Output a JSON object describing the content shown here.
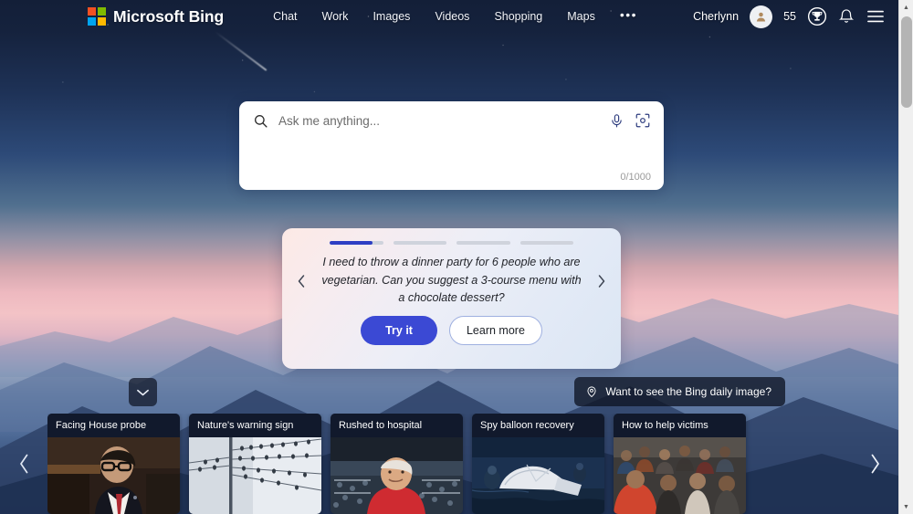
{
  "header": {
    "brand": "Microsoft Bing",
    "logo_colors": [
      "#f25022",
      "#7fba00",
      "#00a4ef",
      "#ffb900"
    ],
    "nav": [
      {
        "label": "Chat",
        "name": "nav-chat"
      },
      {
        "label": "Work",
        "name": "nav-work"
      },
      {
        "label": "Images",
        "name": "nav-images"
      },
      {
        "label": "Videos",
        "name": "nav-videos"
      },
      {
        "label": "Shopping",
        "name": "nav-shopping"
      },
      {
        "label": "Maps",
        "name": "nav-maps"
      }
    ],
    "more_label": "•••",
    "user_name": "Cherlynn",
    "reward_points": "55"
  },
  "search": {
    "placeholder": "Ask me anything...",
    "value": "",
    "char_count": "0/1000"
  },
  "suggestion_card": {
    "progress": [
      {
        "fill_percent": 80
      },
      {
        "fill_percent": 0
      },
      {
        "fill_percent": 0
      },
      {
        "fill_percent": 0
      }
    ],
    "text": "I need to throw a dinner party for 6 people who are vegetarian. Can you suggest a 3-course menu with a chocolate dessert?",
    "primary_button": "Try it",
    "secondary_button": "Learn more"
  },
  "daily_image_pill": {
    "label": "Want to see the Bing daily image?"
  },
  "news_feed": {
    "cards": [
      {
        "title": "Facing House probe",
        "theme": "hearing"
      },
      {
        "title": "Nature's warning sign",
        "theme": "wires"
      },
      {
        "title": "Rushed to hospital",
        "theme": "stadium"
      },
      {
        "title": "Spy balloon recovery",
        "theme": "sea"
      },
      {
        "title": "How to help victims",
        "theme": "crowd"
      }
    ]
  },
  "colors": {
    "accent_blue": "#3b49d4",
    "progress_blue": "#2e3fc4",
    "card_overlay": "rgba(16,24,42,.92)"
  }
}
